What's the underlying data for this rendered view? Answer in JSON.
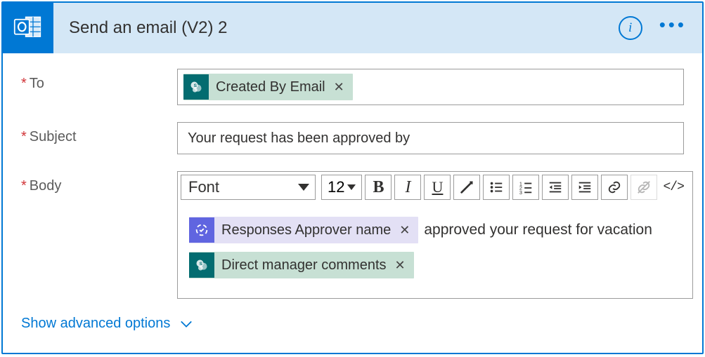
{
  "header": {
    "title": "Send an email (V2) 2",
    "icon": "outlook-icon",
    "info_tooltip": "i",
    "more": "•••"
  },
  "fields": {
    "to": {
      "label": "To",
      "required": true,
      "tokens": [
        {
          "type": "sharepoint",
          "label": "Created By Email"
        }
      ]
    },
    "subject": {
      "label": "Subject",
      "required": true,
      "value": "Your request has been approved by"
    },
    "body": {
      "label": "Body",
      "required": true,
      "toolbar": {
        "font": "Font",
        "size": "12"
      },
      "content": {
        "line1_token": {
          "type": "approvals",
          "label": "Responses Approver name"
        },
        "line1_text": "approved your request for vacation",
        "line2_token": {
          "type": "sharepoint",
          "label": "Direct manager comments"
        }
      }
    }
  },
  "advanced": {
    "label": "Show advanced options"
  }
}
